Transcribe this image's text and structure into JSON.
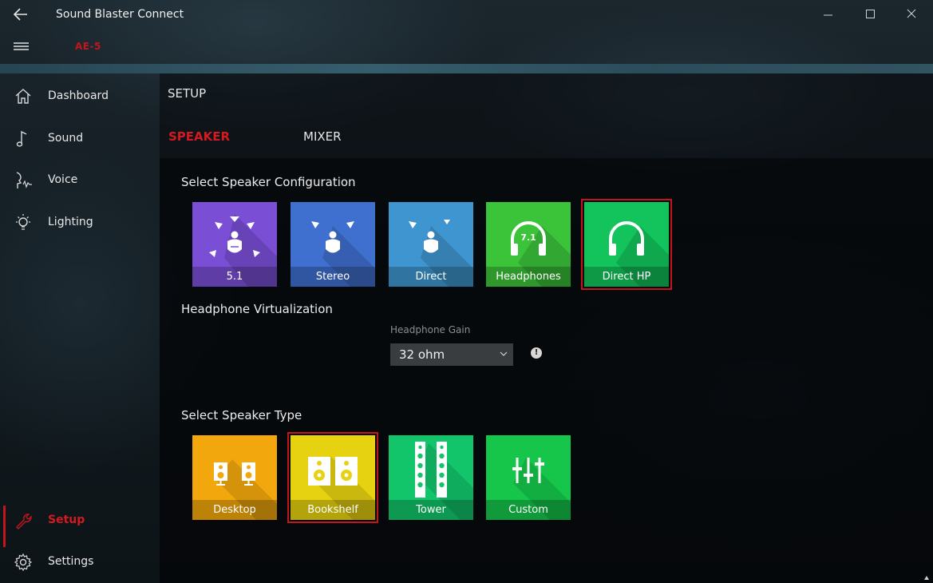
{
  "window": {
    "title": "Sound Blaster Connect",
    "device": "AE-5"
  },
  "sidebar": {
    "items": [
      {
        "label": "Dashboard",
        "icon": "home-icon"
      },
      {
        "label": "Sound",
        "icon": "music-note-icon"
      },
      {
        "label": "Voice",
        "icon": "voice-icon"
      },
      {
        "label": "Lighting",
        "icon": "lightbulb-icon"
      },
      {
        "label": "Setup",
        "icon": "wrench-icon",
        "active": true
      },
      {
        "label": "Settings",
        "icon": "gear-icon"
      }
    ]
  },
  "main": {
    "title": "SETUP",
    "tabs": [
      {
        "label": "SPEAKER",
        "active": true
      },
      {
        "label": "MIXER",
        "active": false
      }
    ],
    "speaker_config": {
      "title": "Select Speaker Configuration",
      "options": [
        {
          "label": "5.1",
          "color": "#7a4fd6",
          "icon": "5-1-surround-icon",
          "selected": false
        },
        {
          "label": "Stereo",
          "color": "#3f6fcf",
          "icon": "stereo-icon",
          "selected": false
        },
        {
          "label": "Direct",
          "color": "#3e95cf",
          "icon": "direct-icon",
          "selected": false
        },
        {
          "label": "Headphones",
          "color": "#3bc33a",
          "icon": "headphones-7-1-icon",
          "selected": false
        },
        {
          "label": "Direct HP",
          "color": "#13c45c",
          "icon": "headphones-icon",
          "selected": true
        }
      ]
    },
    "headphone_virtualization": {
      "title": "Headphone Virtualization",
      "gain_label": "Headphone Gain",
      "gain_value": "32 ohm",
      "info": "!"
    },
    "speaker_type": {
      "title": "Select Speaker Type",
      "options": [
        {
          "label": "Desktop",
          "color": "#f2a80c",
          "icon": "desktop-speakers-icon",
          "selected": false
        },
        {
          "label": "Bookshelf",
          "color": "#e6d210",
          "icon": "bookshelf-speakers-icon",
          "selected": true
        },
        {
          "label": "Tower",
          "color": "#12c46a",
          "icon": "tower-speakers-icon",
          "selected": false
        },
        {
          "label": "Custom",
          "color": "#16c64b",
          "icon": "sliders-icon",
          "selected": false
        }
      ]
    }
  }
}
